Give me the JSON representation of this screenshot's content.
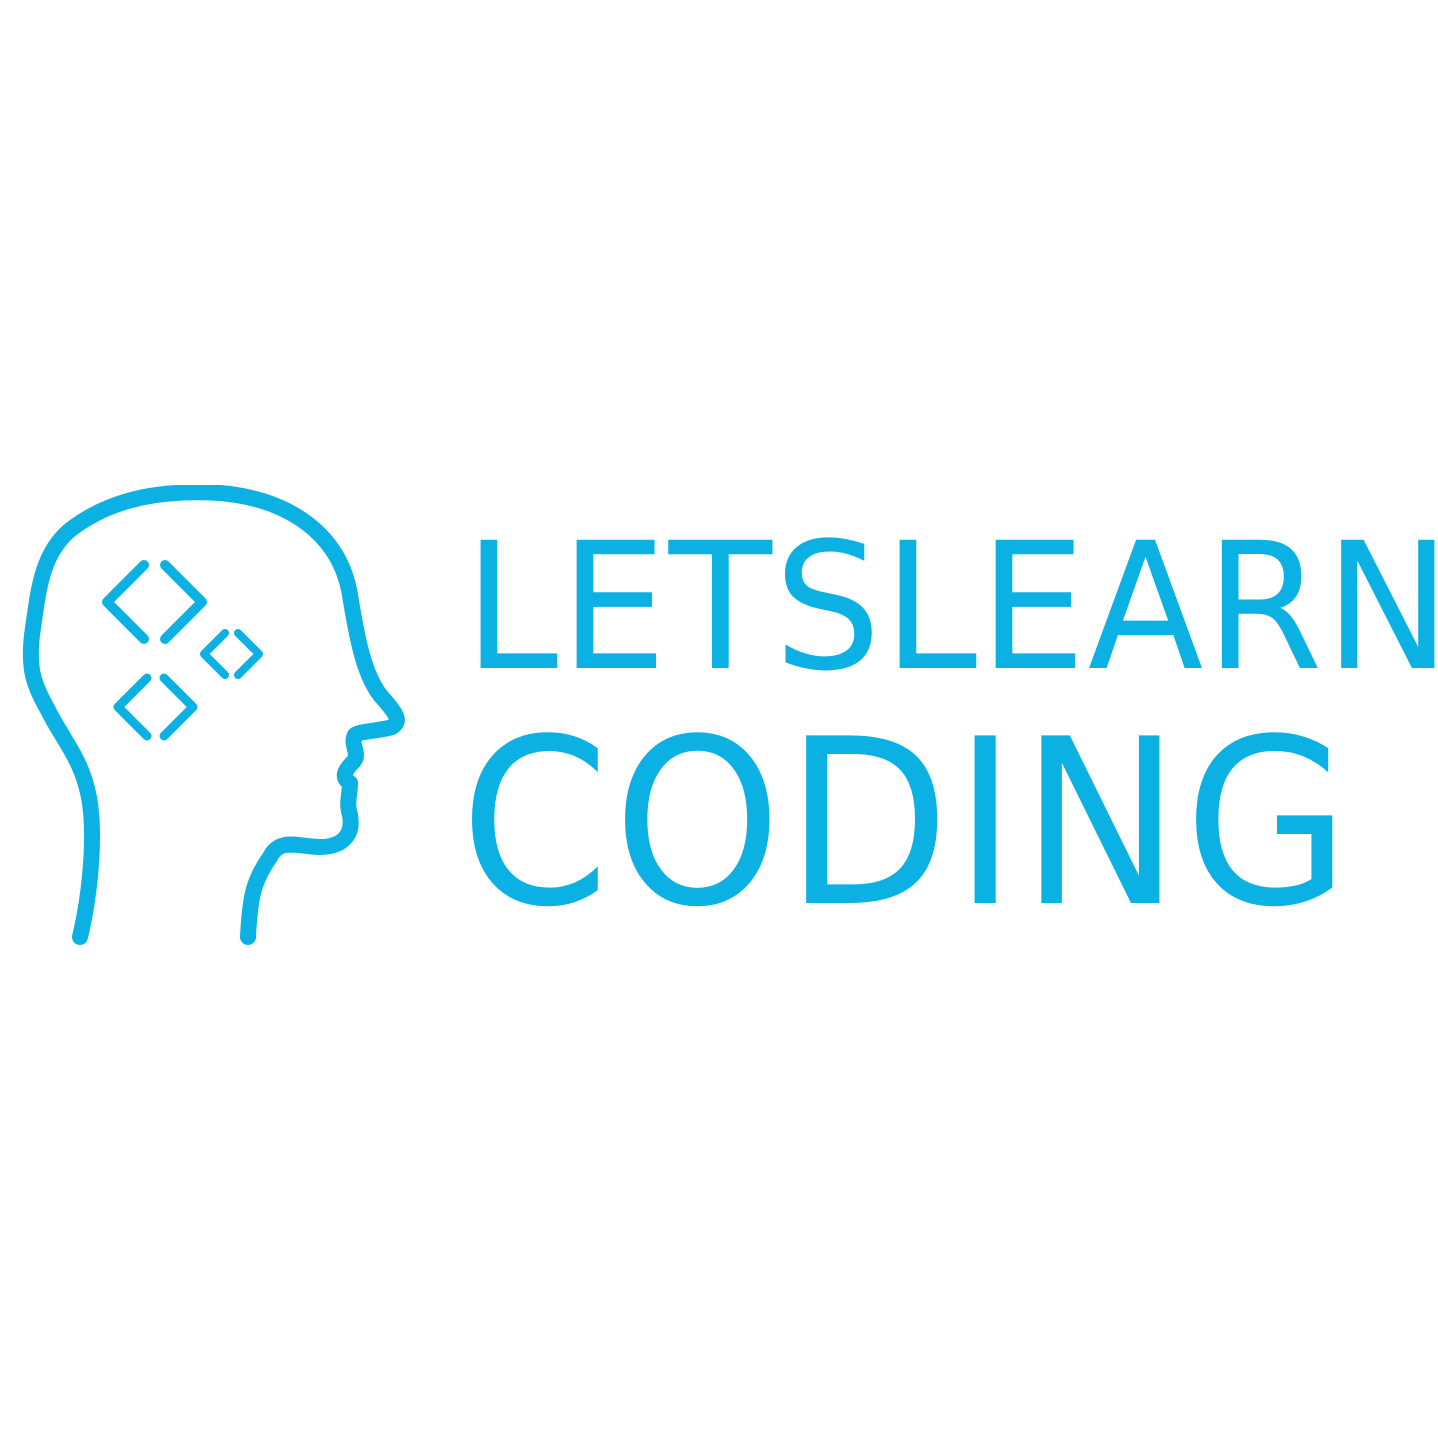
{
  "brand": {
    "line1": "LETSLEARN",
    "line2": "CODING",
    "color": "#0cb1e4"
  },
  "icons": {
    "head": "head-profile-icon",
    "code_tags": [
      "code-brackets-icon",
      "code-brackets-icon",
      "code-brackets-icon"
    ]
  }
}
